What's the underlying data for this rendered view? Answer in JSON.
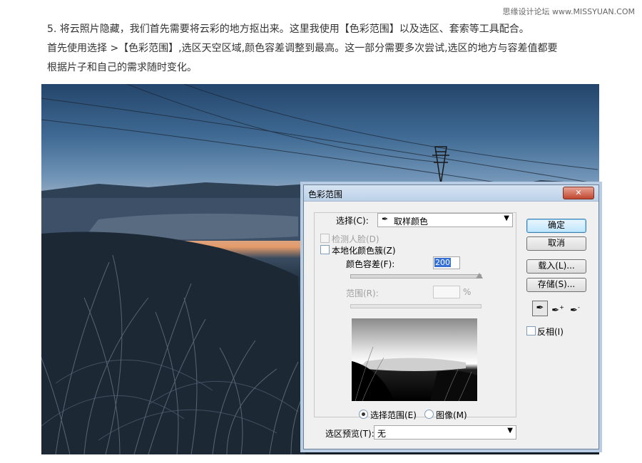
{
  "watermark": "思缘设计论坛 www.MISSYUAN.COM",
  "article": {
    "line1": "5. 将云照片隐藏，我们首先需要将云彩的地方抠出来。这里我使用【色彩范围】以及选区、套索等工具配合。",
    "line2": "首先使用选择 >【色彩范围】,选区天空区域,颜色容差调整到最高。这一部分需要多次尝试,选区的地方与容差值都要",
    "line3": "根据片子和自己的需求随时变化。"
  },
  "dialog": {
    "title": "色彩范围",
    "close_icon": "close-icon",
    "select_label": "选择(C):",
    "select_value": "取样颜色",
    "detect_faces": "检测人脸(D)",
    "localized_clusters": "本地化颜色簇(Z)",
    "fuzziness_label": "颜色容差(F):",
    "fuzziness_value": "200",
    "range_label": "范围(R):",
    "range_unit": "%",
    "radio_selection": "选择范围(E)",
    "radio_image": "图像(M)",
    "preview_label": "选区预览(T):",
    "preview_value": "无",
    "buttons": {
      "ok": "确定",
      "cancel": "取消",
      "load": "载入(L)...",
      "save": "存储(S)..."
    },
    "invert": "反相(I)",
    "tools": [
      "eyedropper-icon",
      "eyedropper-plus-icon",
      "eyedropper-minus-icon"
    ]
  }
}
